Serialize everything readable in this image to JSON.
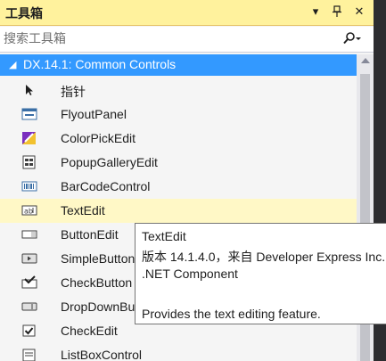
{
  "window": {
    "title": "工具箱",
    "dropdown_glyph": "▾",
    "pin_glyph": "ᵖ",
    "close_glyph": "✕"
  },
  "search": {
    "placeholder": "搜索工具箱"
  },
  "group": {
    "arrow": "◢",
    "label": "DX.14.1: Common Controls"
  },
  "items": [
    {
      "label": "指针",
      "icon": "pointer-icon"
    },
    {
      "label": "FlyoutPanel",
      "icon": "flyout-panel-icon"
    },
    {
      "label": "ColorPickEdit",
      "icon": "color-pick-icon"
    },
    {
      "label": "PopupGalleryEdit",
      "icon": "popup-gallery-icon"
    },
    {
      "label": "BarCodeControl",
      "icon": "barcode-icon"
    },
    {
      "label": "TextEdit",
      "icon": "text-edit-icon",
      "selected": true
    },
    {
      "label": "ButtonEdit",
      "icon": "button-edit-icon"
    },
    {
      "label": "SimpleButton",
      "icon": "simple-button-icon"
    },
    {
      "label": "CheckButton",
      "icon": "check-button-icon"
    },
    {
      "label": "DropDownButton",
      "icon": "dropdown-button-icon"
    },
    {
      "label": "CheckEdit",
      "icon": "check-edit-icon"
    },
    {
      "label": "ListBoxControl",
      "icon": "listbox-icon"
    }
  ],
  "tooltip": {
    "line1": "TextEdit",
    "line2": "版本 14.1.4.0，来自 Developer Express Inc.",
    "line3": ".NET Component",
    "line4": "Provides the text editing feature."
  },
  "colors": {
    "title_bar": "#FFF29D",
    "group_header": "#3399FF",
    "selected_row": "#FFF8C6"
  }
}
